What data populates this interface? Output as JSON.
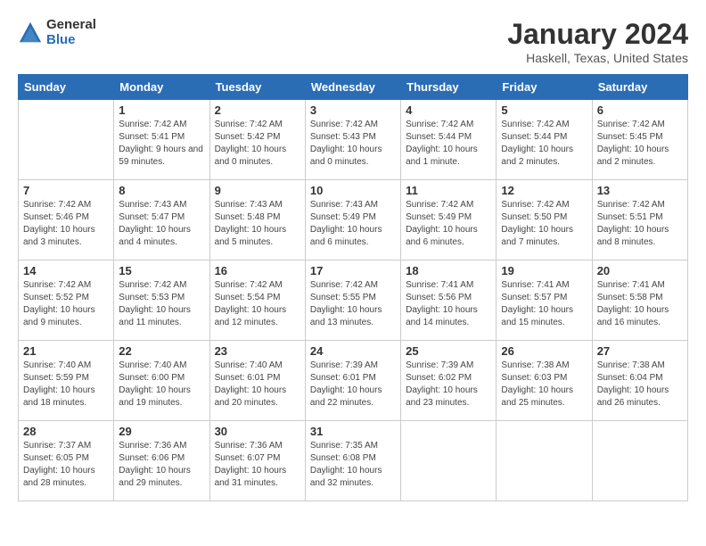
{
  "logo": {
    "general": "General",
    "blue": "Blue"
  },
  "title": "January 2024",
  "subtitle": "Haskell, Texas, United States",
  "weekdays": [
    "Sunday",
    "Monday",
    "Tuesday",
    "Wednesday",
    "Thursday",
    "Friday",
    "Saturday"
  ],
  "weeks": [
    [
      {
        "day": "",
        "sunrise": "",
        "sunset": "",
        "daylight": ""
      },
      {
        "day": "1",
        "sunrise": "Sunrise: 7:42 AM",
        "sunset": "Sunset: 5:41 PM",
        "daylight": "Daylight: 9 hours and 59 minutes."
      },
      {
        "day": "2",
        "sunrise": "Sunrise: 7:42 AM",
        "sunset": "Sunset: 5:42 PM",
        "daylight": "Daylight: 10 hours and 0 minutes."
      },
      {
        "day": "3",
        "sunrise": "Sunrise: 7:42 AM",
        "sunset": "Sunset: 5:43 PM",
        "daylight": "Daylight: 10 hours and 0 minutes."
      },
      {
        "day": "4",
        "sunrise": "Sunrise: 7:42 AM",
        "sunset": "Sunset: 5:44 PM",
        "daylight": "Daylight: 10 hours and 1 minute."
      },
      {
        "day": "5",
        "sunrise": "Sunrise: 7:42 AM",
        "sunset": "Sunset: 5:44 PM",
        "daylight": "Daylight: 10 hours and 2 minutes."
      },
      {
        "day": "6",
        "sunrise": "Sunrise: 7:42 AM",
        "sunset": "Sunset: 5:45 PM",
        "daylight": "Daylight: 10 hours and 2 minutes."
      }
    ],
    [
      {
        "day": "7",
        "sunrise": "Sunrise: 7:42 AM",
        "sunset": "Sunset: 5:46 PM",
        "daylight": "Daylight: 10 hours and 3 minutes."
      },
      {
        "day": "8",
        "sunrise": "Sunrise: 7:43 AM",
        "sunset": "Sunset: 5:47 PM",
        "daylight": "Daylight: 10 hours and 4 minutes."
      },
      {
        "day": "9",
        "sunrise": "Sunrise: 7:43 AM",
        "sunset": "Sunset: 5:48 PM",
        "daylight": "Daylight: 10 hours and 5 minutes."
      },
      {
        "day": "10",
        "sunrise": "Sunrise: 7:43 AM",
        "sunset": "Sunset: 5:49 PM",
        "daylight": "Daylight: 10 hours and 6 minutes."
      },
      {
        "day": "11",
        "sunrise": "Sunrise: 7:42 AM",
        "sunset": "Sunset: 5:49 PM",
        "daylight": "Daylight: 10 hours and 6 minutes."
      },
      {
        "day": "12",
        "sunrise": "Sunrise: 7:42 AM",
        "sunset": "Sunset: 5:50 PM",
        "daylight": "Daylight: 10 hours and 7 minutes."
      },
      {
        "day": "13",
        "sunrise": "Sunrise: 7:42 AM",
        "sunset": "Sunset: 5:51 PM",
        "daylight": "Daylight: 10 hours and 8 minutes."
      }
    ],
    [
      {
        "day": "14",
        "sunrise": "Sunrise: 7:42 AM",
        "sunset": "Sunset: 5:52 PM",
        "daylight": "Daylight: 10 hours and 9 minutes."
      },
      {
        "day": "15",
        "sunrise": "Sunrise: 7:42 AM",
        "sunset": "Sunset: 5:53 PM",
        "daylight": "Daylight: 10 hours and 11 minutes."
      },
      {
        "day": "16",
        "sunrise": "Sunrise: 7:42 AM",
        "sunset": "Sunset: 5:54 PM",
        "daylight": "Daylight: 10 hours and 12 minutes."
      },
      {
        "day": "17",
        "sunrise": "Sunrise: 7:42 AM",
        "sunset": "Sunset: 5:55 PM",
        "daylight": "Daylight: 10 hours and 13 minutes."
      },
      {
        "day": "18",
        "sunrise": "Sunrise: 7:41 AM",
        "sunset": "Sunset: 5:56 PM",
        "daylight": "Daylight: 10 hours and 14 minutes."
      },
      {
        "day": "19",
        "sunrise": "Sunrise: 7:41 AM",
        "sunset": "Sunset: 5:57 PM",
        "daylight": "Daylight: 10 hours and 15 minutes."
      },
      {
        "day": "20",
        "sunrise": "Sunrise: 7:41 AM",
        "sunset": "Sunset: 5:58 PM",
        "daylight": "Daylight: 10 hours and 16 minutes."
      }
    ],
    [
      {
        "day": "21",
        "sunrise": "Sunrise: 7:40 AM",
        "sunset": "Sunset: 5:59 PM",
        "daylight": "Daylight: 10 hours and 18 minutes."
      },
      {
        "day": "22",
        "sunrise": "Sunrise: 7:40 AM",
        "sunset": "Sunset: 6:00 PM",
        "daylight": "Daylight: 10 hours and 19 minutes."
      },
      {
        "day": "23",
        "sunrise": "Sunrise: 7:40 AM",
        "sunset": "Sunset: 6:01 PM",
        "daylight": "Daylight: 10 hours and 20 minutes."
      },
      {
        "day": "24",
        "sunrise": "Sunrise: 7:39 AM",
        "sunset": "Sunset: 6:01 PM",
        "daylight": "Daylight: 10 hours and 22 minutes."
      },
      {
        "day": "25",
        "sunrise": "Sunrise: 7:39 AM",
        "sunset": "Sunset: 6:02 PM",
        "daylight": "Daylight: 10 hours and 23 minutes."
      },
      {
        "day": "26",
        "sunrise": "Sunrise: 7:38 AM",
        "sunset": "Sunset: 6:03 PM",
        "daylight": "Daylight: 10 hours and 25 minutes."
      },
      {
        "day": "27",
        "sunrise": "Sunrise: 7:38 AM",
        "sunset": "Sunset: 6:04 PM",
        "daylight": "Daylight: 10 hours and 26 minutes."
      }
    ],
    [
      {
        "day": "28",
        "sunrise": "Sunrise: 7:37 AM",
        "sunset": "Sunset: 6:05 PM",
        "daylight": "Daylight: 10 hours and 28 minutes."
      },
      {
        "day": "29",
        "sunrise": "Sunrise: 7:36 AM",
        "sunset": "Sunset: 6:06 PM",
        "daylight": "Daylight: 10 hours and 29 minutes."
      },
      {
        "day": "30",
        "sunrise": "Sunrise: 7:36 AM",
        "sunset": "Sunset: 6:07 PM",
        "daylight": "Daylight: 10 hours and 31 minutes."
      },
      {
        "day": "31",
        "sunrise": "Sunrise: 7:35 AM",
        "sunset": "Sunset: 6:08 PM",
        "daylight": "Daylight: 10 hours and 32 minutes."
      },
      {
        "day": "",
        "sunrise": "",
        "sunset": "",
        "daylight": ""
      },
      {
        "day": "",
        "sunrise": "",
        "sunset": "",
        "daylight": ""
      },
      {
        "day": "",
        "sunrise": "",
        "sunset": "",
        "daylight": ""
      }
    ]
  ]
}
